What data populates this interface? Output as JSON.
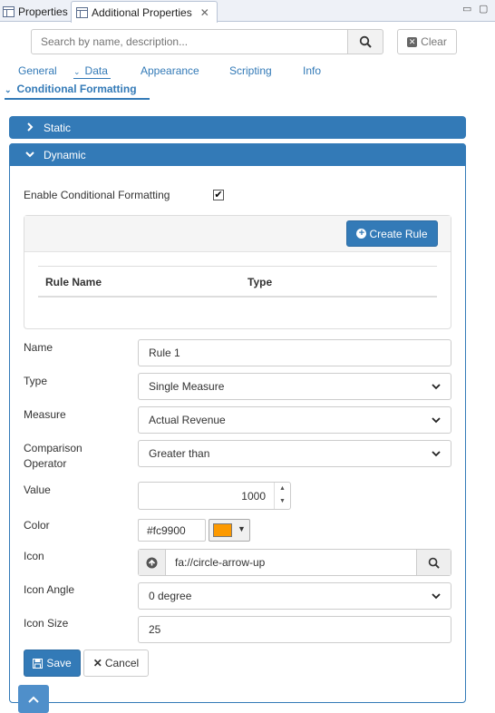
{
  "tabs": {
    "properties": "Properties",
    "additional": "Additional Properties",
    "close_glyph": "✕"
  },
  "window_controls": {
    "minimize": "▭",
    "maximize": "▢"
  },
  "search": {
    "placeholder": "Search by name, description...",
    "clear_label": "Clear"
  },
  "nav": {
    "general": "General",
    "data": "Data",
    "appearance": "Appearance",
    "scripting": "Scripting",
    "info": "Info"
  },
  "section": {
    "title": "Conditional Formatting"
  },
  "panels": {
    "static": "Static",
    "dynamic": "Dynamic"
  },
  "enable": {
    "label": "Enable Conditional Formatting",
    "checked": true,
    "check_glyph": "✔"
  },
  "rules": {
    "create_label": "Create Rule",
    "columns": [
      "Rule Name",
      "Type"
    ]
  },
  "form": {
    "name": {
      "label": "Name",
      "value": "Rule 1"
    },
    "type": {
      "label": "Type",
      "value": "Single Measure"
    },
    "measure": {
      "label": "Measure",
      "value": "Actual Revenue"
    },
    "operator": {
      "label_line1": "Comparison",
      "label_line2": "Operator",
      "value": "Greater than"
    },
    "value": {
      "label": "Value",
      "value": "1000"
    },
    "color": {
      "label": "Color",
      "value": "#fc9900",
      "swatch": "#fc9900"
    },
    "icon": {
      "label": "Icon",
      "value": "fa://circle-arrow-up",
      "preview_icon": "circle-arrow-up-icon"
    },
    "icon_angle": {
      "label": "Icon Angle",
      "value": "0 degree"
    },
    "icon_size": {
      "label": "Icon Size",
      "value": "25"
    }
  },
  "actions": {
    "save": "Save",
    "cancel": "Cancel"
  },
  "colors": {
    "accent": "#337ab7",
    "swatch": "#fc9900"
  }
}
